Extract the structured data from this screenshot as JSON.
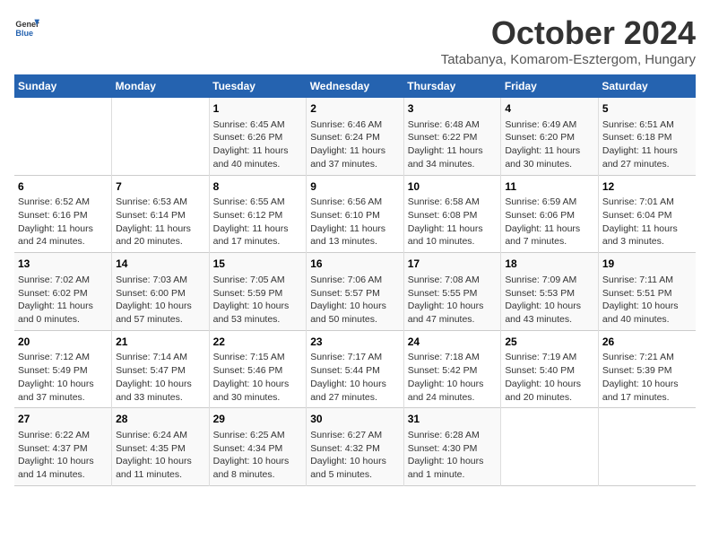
{
  "logo": {
    "line1": "General",
    "line2": "Blue"
  },
  "title": "October 2024",
  "subtitle": "Tatabanya, Komarom-Esztergom, Hungary",
  "days_header": [
    "Sunday",
    "Monday",
    "Tuesday",
    "Wednesday",
    "Thursday",
    "Friday",
    "Saturday"
  ],
  "weeks": [
    [
      {
        "num": "",
        "info": ""
      },
      {
        "num": "",
        "info": ""
      },
      {
        "num": "1",
        "info": "Sunrise: 6:45 AM\nSunset: 6:26 PM\nDaylight: 11 hours and 40 minutes."
      },
      {
        "num": "2",
        "info": "Sunrise: 6:46 AM\nSunset: 6:24 PM\nDaylight: 11 hours and 37 minutes."
      },
      {
        "num": "3",
        "info": "Sunrise: 6:48 AM\nSunset: 6:22 PM\nDaylight: 11 hours and 34 minutes."
      },
      {
        "num": "4",
        "info": "Sunrise: 6:49 AM\nSunset: 6:20 PM\nDaylight: 11 hours and 30 minutes."
      },
      {
        "num": "5",
        "info": "Sunrise: 6:51 AM\nSunset: 6:18 PM\nDaylight: 11 hours and 27 minutes."
      }
    ],
    [
      {
        "num": "6",
        "info": "Sunrise: 6:52 AM\nSunset: 6:16 PM\nDaylight: 11 hours and 24 minutes."
      },
      {
        "num": "7",
        "info": "Sunrise: 6:53 AM\nSunset: 6:14 PM\nDaylight: 11 hours and 20 minutes."
      },
      {
        "num": "8",
        "info": "Sunrise: 6:55 AM\nSunset: 6:12 PM\nDaylight: 11 hours and 17 minutes."
      },
      {
        "num": "9",
        "info": "Sunrise: 6:56 AM\nSunset: 6:10 PM\nDaylight: 11 hours and 13 minutes."
      },
      {
        "num": "10",
        "info": "Sunrise: 6:58 AM\nSunset: 6:08 PM\nDaylight: 11 hours and 10 minutes."
      },
      {
        "num": "11",
        "info": "Sunrise: 6:59 AM\nSunset: 6:06 PM\nDaylight: 11 hours and 7 minutes."
      },
      {
        "num": "12",
        "info": "Sunrise: 7:01 AM\nSunset: 6:04 PM\nDaylight: 11 hours and 3 minutes."
      }
    ],
    [
      {
        "num": "13",
        "info": "Sunrise: 7:02 AM\nSunset: 6:02 PM\nDaylight: 11 hours and 0 minutes."
      },
      {
        "num": "14",
        "info": "Sunrise: 7:03 AM\nSunset: 6:00 PM\nDaylight: 10 hours and 57 minutes."
      },
      {
        "num": "15",
        "info": "Sunrise: 7:05 AM\nSunset: 5:59 PM\nDaylight: 10 hours and 53 minutes."
      },
      {
        "num": "16",
        "info": "Sunrise: 7:06 AM\nSunset: 5:57 PM\nDaylight: 10 hours and 50 minutes."
      },
      {
        "num": "17",
        "info": "Sunrise: 7:08 AM\nSunset: 5:55 PM\nDaylight: 10 hours and 47 minutes."
      },
      {
        "num": "18",
        "info": "Sunrise: 7:09 AM\nSunset: 5:53 PM\nDaylight: 10 hours and 43 minutes."
      },
      {
        "num": "19",
        "info": "Sunrise: 7:11 AM\nSunset: 5:51 PM\nDaylight: 10 hours and 40 minutes."
      }
    ],
    [
      {
        "num": "20",
        "info": "Sunrise: 7:12 AM\nSunset: 5:49 PM\nDaylight: 10 hours and 37 minutes."
      },
      {
        "num": "21",
        "info": "Sunrise: 7:14 AM\nSunset: 5:47 PM\nDaylight: 10 hours and 33 minutes."
      },
      {
        "num": "22",
        "info": "Sunrise: 7:15 AM\nSunset: 5:46 PM\nDaylight: 10 hours and 30 minutes."
      },
      {
        "num": "23",
        "info": "Sunrise: 7:17 AM\nSunset: 5:44 PM\nDaylight: 10 hours and 27 minutes."
      },
      {
        "num": "24",
        "info": "Sunrise: 7:18 AM\nSunset: 5:42 PM\nDaylight: 10 hours and 24 minutes."
      },
      {
        "num": "25",
        "info": "Sunrise: 7:19 AM\nSunset: 5:40 PM\nDaylight: 10 hours and 20 minutes."
      },
      {
        "num": "26",
        "info": "Sunrise: 7:21 AM\nSunset: 5:39 PM\nDaylight: 10 hours and 17 minutes."
      }
    ],
    [
      {
        "num": "27",
        "info": "Sunrise: 6:22 AM\nSunset: 4:37 PM\nDaylight: 10 hours and 14 minutes."
      },
      {
        "num": "28",
        "info": "Sunrise: 6:24 AM\nSunset: 4:35 PM\nDaylight: 10 hours and 11 minutes."
      },
      {
        "num": "29",
        "info": "Sunrise: 6:25 AM\nSunset: 4:34 PM\nDaylight: 10 hours and 8 minutes."
      },
      {
        "num": "30",
        "info": "Sunrise: 6:27 AM\nSunset: 4:32 PM\nDaylight: 10 hours and 5 minutes."
      },
      {
        "num": "31",
        "info": "Sunrise: 6:28 AM\nSunset: 4:30 PM\nDaylight: 10 hours and 1 minute."
      },
      {
        "num": "",
        "info": ""
      },
      {
        "num": "",
        "info": ""
      }
    ]
  ]
}
